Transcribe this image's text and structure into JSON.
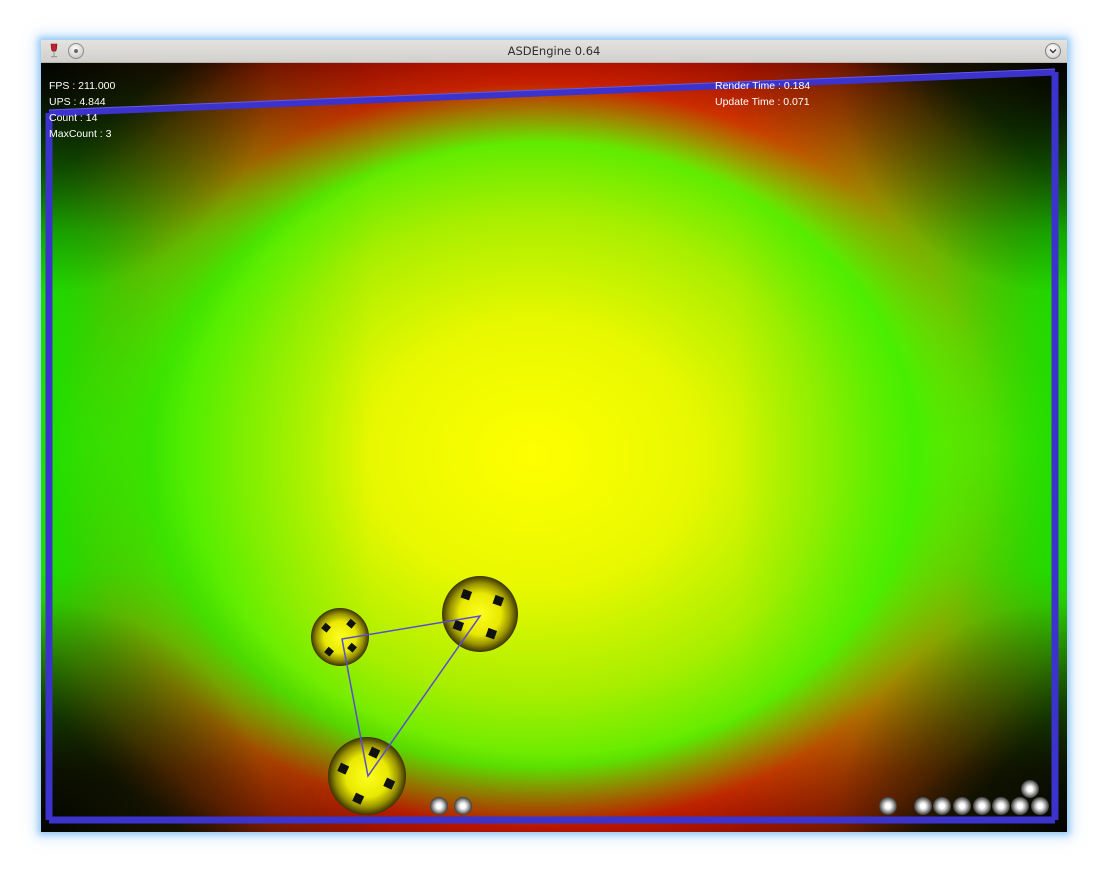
{
  "window": {
    "title": "ASDEngine 0.64"
  },
  "hud": {
    "fps": "FPS : 211.000",
    "ups": "UPS : 4.844",
    "count": "Count : 14",
    "max_count": "MaxCount : 3",
    "render_time": "Render Time : 0.184",
    "update_time": "Update Time : 0.071"
  },
  "colors": {
    "background_center": "#ffff00",
    "background_mid": "#ff8c00",
    "background_edge_top_bottom": "#ff1a00",
    "background_sides": "#22e800",
    "boundary": "#3b33cc",
    "big_ball": "#e6e600",
    "link_line": "#5a4dd0"
  },
  "scene": {
    "big_balls_count": 3,
    "small_balls_count": 11
  }
}
